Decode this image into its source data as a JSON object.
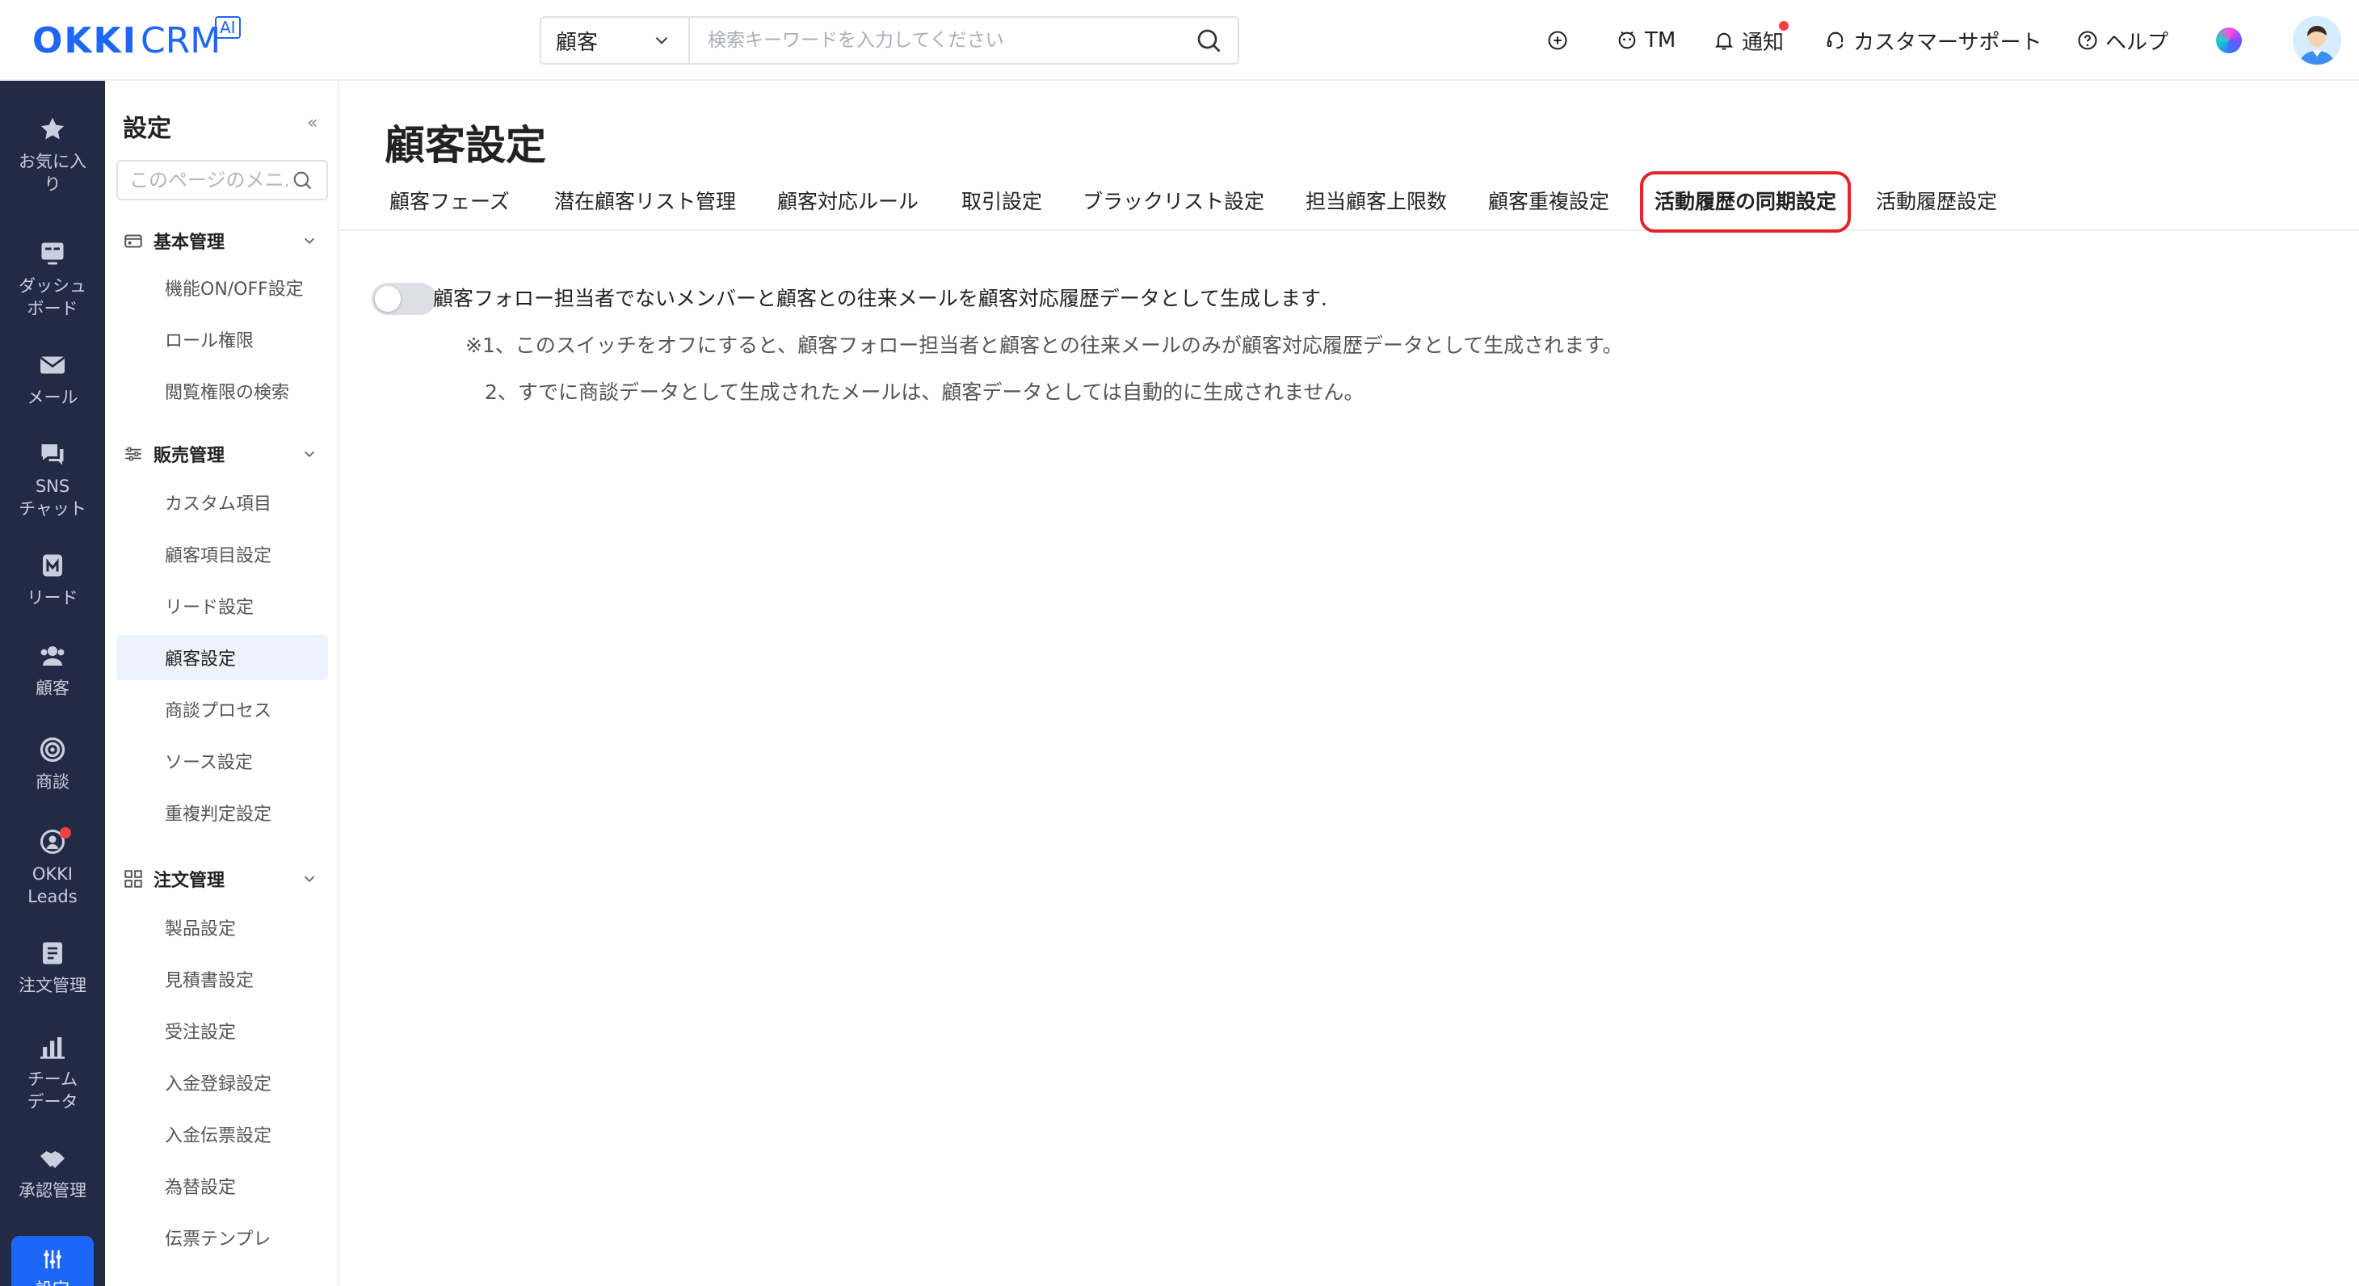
{
  "brand": {
    "name_bold": "OKKI",
    "name_rest": "CRM",
    "badge": "AI"
  },
  "search": {
    "scope": "顧客",
    "placeholder": "検索キーワードを入力してください"
  },
  "topbar": {
    "tm": "TM",
    "notice": "通知",
    "support": "カスタマーサポート",
    "help": "ヘルプ"
  },
  "leftnav": {
    "favorites": [
      "お気に入",
      "り"
    ],
    "dashboard": [
      "ダッシュ",
      "ボード"
    ],
    "mail": "メール",
    "sns": [
      "SNS",
      "チャット"
    ],
    "lead": "リード",
    "customer": "顧客",
    "deal": "商談",
    "okki_leads": [
      "OKKI",
      "Leads"
    ],
    "orders": "注文管理",
    "team": [
      "チーム",
      "データ"
    ],
    "approval": "承認管理",
    "settings": "設定"
  },
  "sidebar": {
    "title": "設定",
    "search_placeholder": "このページのメニ...",
    "groups": [
      {
        "label": "基本管理",
        "items": [
          "機能ON/OFF設定",
          "ロール権限",
          "閲覧権限の検索"
        ]
      },
      {
        "label": "販売管理",
        "items": [
          "カスタム項目",
          "顧客項目設定",
          "リード設定",
          "顧客設定",
          "商談プロセス",
          "ソース設定",
          "重複判定設定"
        ]
      },
      {
        "label": "注文管理",
        "items": [
          "製品設定",
          "見積書設定",
          "受注設定",
          "入金登録設定",
          "入金伝票設定",
          "為替設定",
          "伝票テンプレ"
        ]
      }
    ],
    "active_item": "顧客設定"
  },
  "main": {
    "title": "顧客設定",
    "tabs": [
      "顧客フェーズ",
      "潜在顧客リスト管理",
      "顧客対応ルール",
      "取引設定",
      "ブラックリスト設定",
      "担当顧客上限数",
      "顧客重複設定",
      "活動履歴の同期設定",
      "活動履歴設定"
    ],
    "active_tab": "活動履歴の同期設定",
    "setting": {
      "enabled": false,
      "description": "顧客フォロー担当者でないメンバーと顧客との往来メールを顧客対応履歴データとして生成します.",
      "note1": "※1、このスイッチをオフにすると、顧客フォロー担当者と顧客との往来メールのみが顧客対応履歴データとして生成されます。",
      "note2": "2、すでに商談データとして生成されたメールは、顧客データとしては自動的に生成されません。"
    }
  },
  "colors": {
    "accent": "#1e66f5",
    "nav_bg": "#222a45",
    "highlight": "#e3242b",
    "alert": "#f53f3f"
  }
}
